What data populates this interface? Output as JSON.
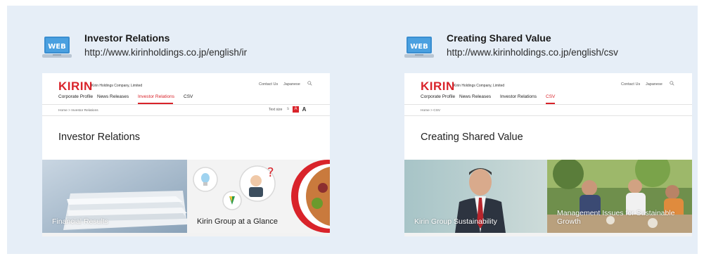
{
  "panels": [
    {
      "icon": "web-laptop-icon",
      "icon_text": "WEB",
      "title": "Investor Relations",
      "url": "http://www.kirinholdings.co.jp/english/ir",
      "site": {
        "logo": "KIRIN",
        "company": "Kirin Holdings Company, Limited",
        "util_links": [
          "Contact Us",
          "Japanese"
        ],
        "nav": [
          "Corporate Profile",
          "News Releases",
          "Investor Relations",
          "CSV"
        ],
        "nav_active": "Investor Relations",
        "breadcrumb": "Home  >  Investor Relations",
        "text_size_label": "Text size",
        "text_size_options": [
          "s",
          "A",
          "A"
        ],
        "page_title": "Investor Relations",
        "tiles": [
          "Financial Results",
          "Kirin Group at a Glance"
        ]
      }
    },
    {
      "icon": "web-laptop-icon",
      "icon_text": "WEB",
      "title": "Creating Shared Value",
      "url": "http://www.kirinholdings.co.jp/english/csv",
      "site": {
        "logo": "KIRIN",
        "company": "Kirin Holdings Company, Limited",
        "util_links": [
          "Contact Us",
          "Japanese"
        ],
        "nav": [
          "Corporate Profile",
          "News Releases",
          "Investor Relations",
          "CSV"
        ],
        "nav_active": "CSV",
        "breadcrumb": "Home  >  CSV",
        "page_title": "Creating Shared Value",
        "tiles": [
          "Kirin Group Sustainability",
          "Management Issues for Sustainable Growth"
        ]
      }
    }
  ],
  "colors": {
    "background": "#e6eef7",
    "brand_red": "#d9232a",
    "icon_blue": "#3a8ed0"
  }
}
